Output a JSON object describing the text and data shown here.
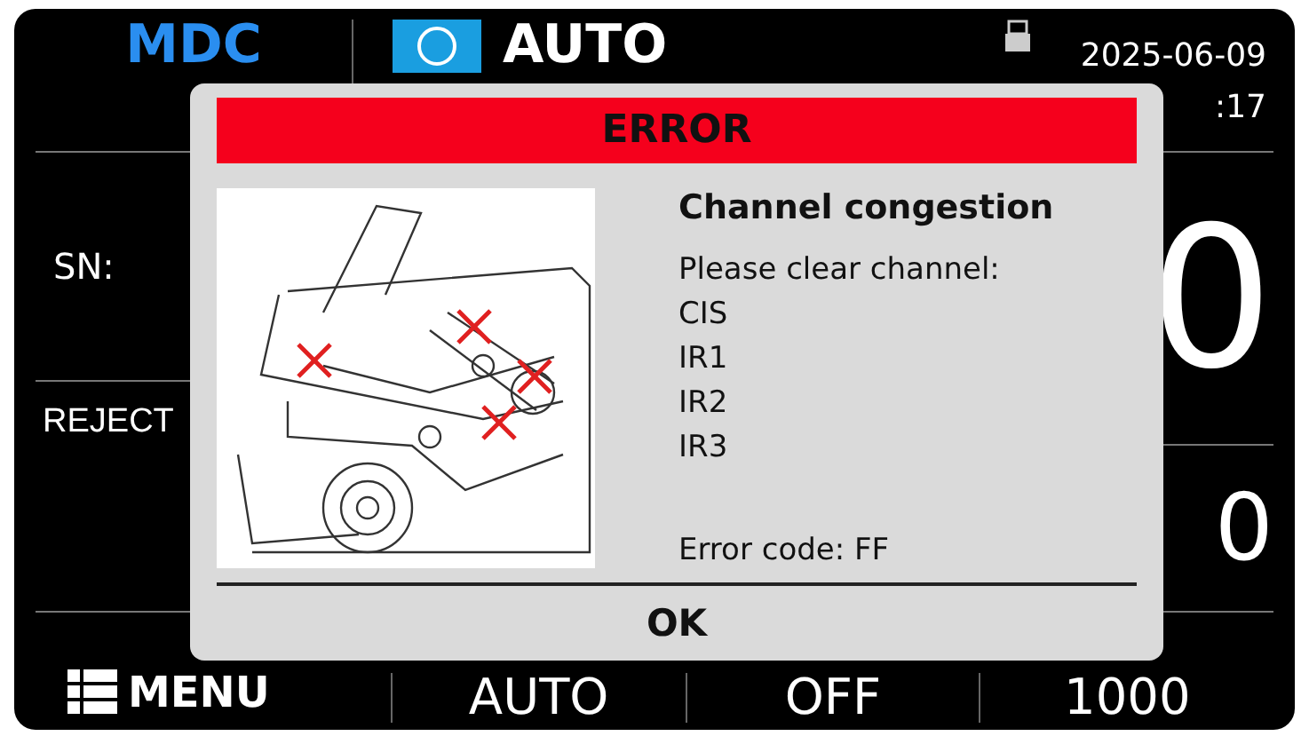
{
  "header": {
    "brand": "MDC",
    "mode": "AUTO",
    "date": "2025-06-09",
    "time": ":17"
  },
  "fields": [
    {
      "label": "SN:"
    },
    {
      "label": "REJECT"
    }
  ],
  "counts": {
    "main": "0",
    "secondary": "0"
  },
  "footer": {
    "menu": "MENU",
    "items": [
      "AUTO",
      "OFF",
      "1000"
    ]
  },
  "dialog": {
    "title": "ERROR",
    "heading": "Channel congestion",
    "lines": [
      "Please clear channel:",
      "CIS",
      "IR1",
      "IR2",
      "IR3"
    ],
    "code": "Error code: FF",
    "button": "OK"
  }
}
